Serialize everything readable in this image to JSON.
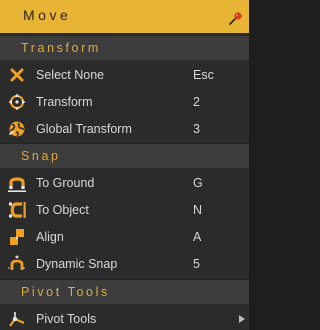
{
  "panel": {
    "title": "Move"
  },
  "sections": {
    "transform": {
      "header": "Transform",
      "items": [
        {
          "label": "Select None",
          "shortcut": "Esc",
          "icon": "x-icon"
        },
        {
          "label": "Transform",
          "shortcut": "2",
          "icon": "transform-gizmo-icon"
        },
        {
          "label": "Global Transform",
          "shortcut": "3",
          "icon": "globe-icon"
        }
      ]
    },
    "snap": {
      "header": "Snap",
      "items": [
        {
          "label": "To Ground",
          "shortcut": "G",
          "icon": "magnet-down-icon"
        },
        {
          "label": "To Object",
          "shortcut": "N",
          "icon": "magnet-right-icon"
        },
        {
          "label": "Align",
          "shortcut": "A",
          "icon": "align-steps-icon"
        },
        {
          "label": "Dynamic Snap",
          "shortcut": "5",
          "icon": "dynamic-snap-icon"
        }
      ]
    },
    "pivot": {
      "header": "Pivot Tools",
      "items": [
        {
          "label": "Pivot Tools",
          "shortcut": "",
          "icon": "pivot-icon",
          "submenu": true
        }
      ]
    }
  },
  "colors": {
    "accent": "#e8b434",
    "section_text": "#e0a93a",
    "icon_orange": "#f0a020",
    "panel_bg": "#2b2b2b",
    "section_bg": "#3c3c3c",
    "pin_red": "#d23a1e"
  }
}
